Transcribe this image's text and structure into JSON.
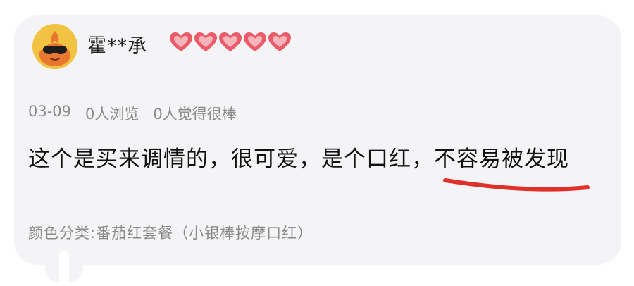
{
  "comment": {
    "username": "霍**承",
    "level_badge": {
      "icon": "heart-icon",
      "count": 5,
      "color": "#ea5b69"
    },
    "date": "03-09",
    "views": "0人浏览",
    "likes": "0人觉得很棒",
    "text": "这个是买来调情的，很可爱，是个口红，不容易被发现",
    "sku": "颜色分类:番茄红套餐（小银棒按摩口红）"
  },
  "annotation": {
    "color": "#e0302a"
  }
}
